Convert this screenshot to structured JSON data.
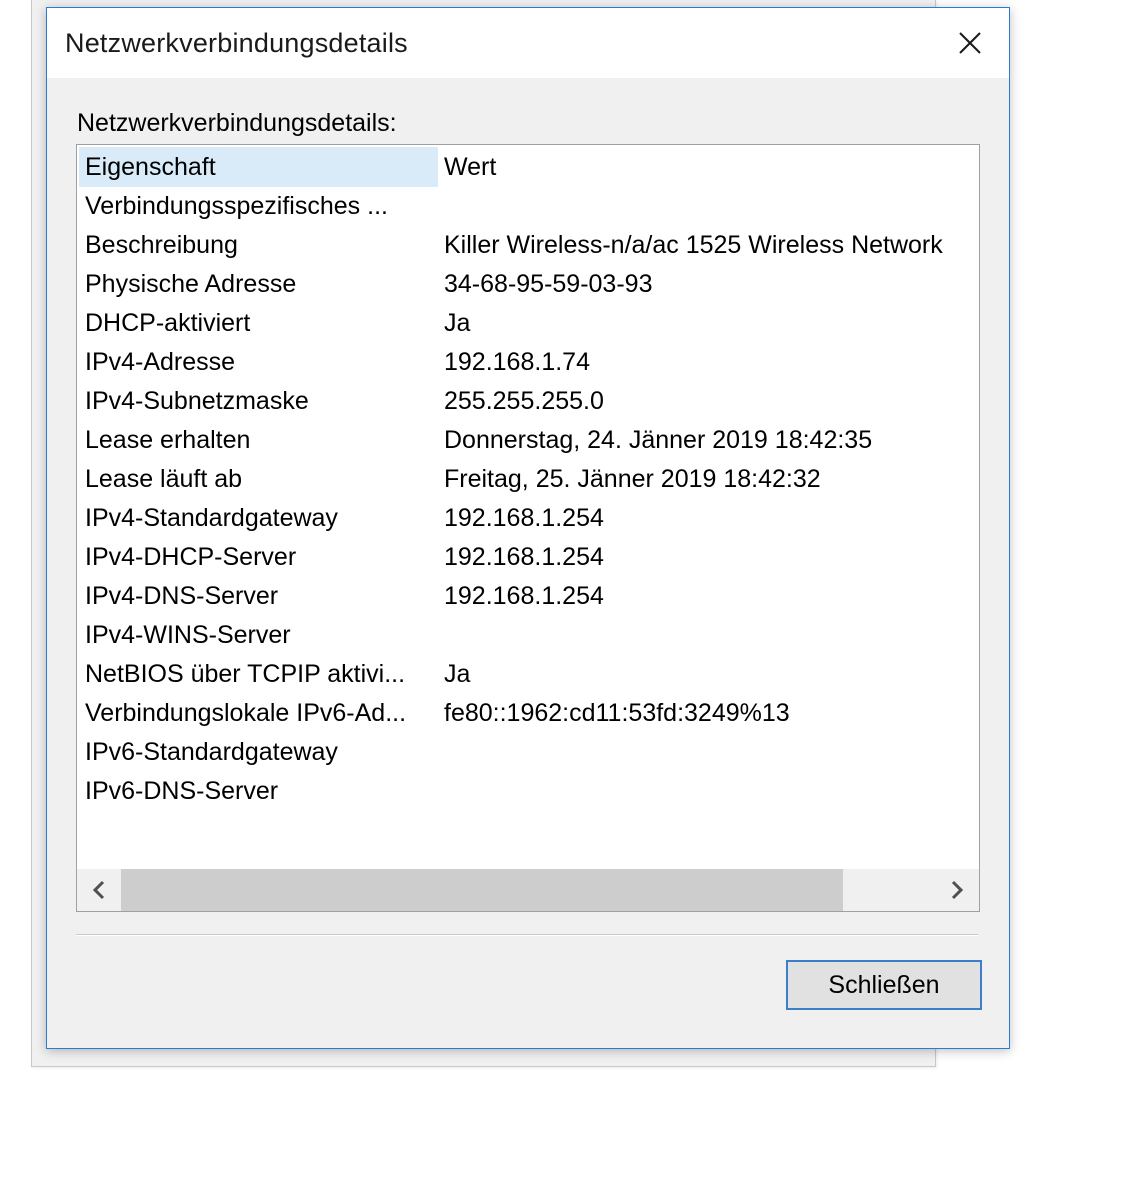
{
  "window": {
    "title": "Netzwerkverbindungsdetails",
    "close_icon": "close-icon"
  },
  "section_label": "Netzwerkverbindungsdetails:",
  "table": {
    "columns": {
      "property": "Eigenschaft",
      "value": "Wert"
    },
    "rows": [
      {
        "property": "Verbindungsspezifisches ...",
        "value": ""
      },
      {
        "property": "Beschreibung",
        "value": "Killer Wireless-n/a/ac 1525 Wireless Network"
      },
      {
        "property": "Physische Adresse",
        "value": "34-68-95-59-03-93"
      },
      {
        "property": "DHCP-aktiviert",
        "value": "Ja"
      },
      {
        "property": "IPv4-Adresse",
        "value": "192.168.1.74"
      },
      {
        "property": "IPv4-Subnetzmaske",
        "value": "255.255.255.0"
      },
      {
        "property": "Lease erhalten",
        "value": "Donnerstag, 24. Jänner 2019 18:42:35"
      },
      {
        "property": "Lease läuft ab",
        "value": "Freitag, 25. Jänner 2019 18:42:32"
      },
      {
        "property": "IPv4-Standardgateway",
        "value": "192.168.1.254"
      },
      {
        "property": "IPv4-DHCP-Server",
        "value": "192.168.1.254"
      },
      {
        "property": "IPv4-DNS-Server",
        "value": "192.168.1.254"
      },
      {
        "property": "IPv4-WINS-Server",
        "value": ""
      },
      {
        "property": "NetBIOS über TCPIP aktivi...",
        "value": "Ja"
      },
      {
        "property": "Verbindungslokale IPv6-Ad...",
        "value": "fe80::1962:cd11:53fd:3249%13"
      },
      {
        "property": "IPv6-Standardgateway",
        "value": ""
      },
      {
        "property": "IPv6-DNS-Server",
        "value": ""
      }
    ]
  },
  "scrollbar": {
    "left_icon": "chevron-left-icon",
    "right_icon": "chevron-right-icon"
  },
  "buttons": {
    "close_label": "Schließen"
  },
  "colors": {
    "accent": "#2b7bd4",
    "header_highlight": "#d9ebf9",
    "dialog_bg": "#f0f0f0"
  }
}
